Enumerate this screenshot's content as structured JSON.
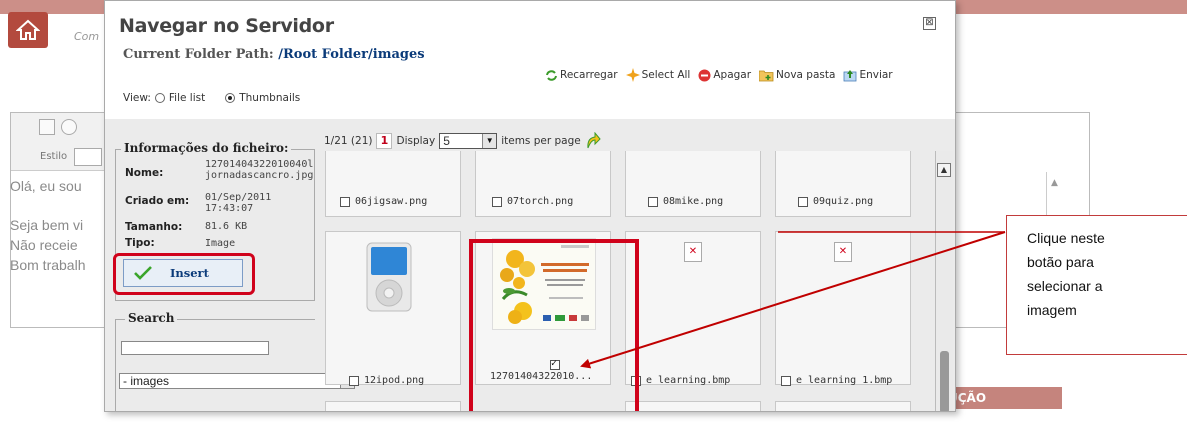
{
  "background": {
    "com_fragment": "Com",
    "estilo_label": "Estilo",
    "editor_lines": [
      "Olá, eu sou",
      "Seja bem vi",
      "Não receie",
      "Bom trabalh"
    ],
    "section_fragment": "UÇÃO"
  },
  "dialog": {
    "title": "Navegar no Servidor",
    "close_symbol": "⊠",
    "folder_path_label": "Current Folder Path: ",
    "folder_path_value": "/Root Folder/images",
    "toolbar": {
      "reload": "Recarregar",
      "select_all": "Select All",
      "delete": "Apagar",
      "new_folder": "Nova pasta",
      "upload": "Enviar"
    },
    "view": {
      "label": "View:",
      "option_list": "File list",
      "option_thumbs": "Thumbnails",
      "selected": "Thumbnails"
    },
    "file_info": {
      "legend": "Informações do ficheiro:",
      "name_label": "Nome:",
      "name_value": "12701404322010040l\njornadascancro.jpg",
      "created_label": "Criado em:",
      "created_value": "01/Sep/2011\n17:43:07",
      "size_label": "Tamanho:",
      "size_value": "81.6 KB",
      "type_label": "Tipo:",
      "type_value": "Image",
      "insert_label": "Insert"
    },
    "search": {
      "legend": "Search",
      "input_value": "",
      "folder_selected": "- images"
    },
    "pager": {
      "range": "1/21 (21)",
      "page": "1",
      "display_label": "Display",
      "per_page_value": "5",
      "per_page_suffix": "items per page"
    },
    "files_row1": [
      "06jigsaw.png",
      "07torch.png",
      "08mike.png",
      "09quiz.png"
    ],
    "files_row2": [
      {
        "name": "12ipod.png",
        "checked": false
      },
      {
        "name": "12701404322010...",
        "checked": true
      },
      {
        "name": "e learning.bmp",
        "checked": false
      },
      {
        "name": "e learning 1.bmp",
        "checked": false
      }
    ]
  },
  "callout": {
    "line1": "Clique neste",
    "line2": "botão para",
    "line3": "selecionar a",
    "line4": "imagem"
  },
  "colors": {
    "annotation_red": "#d0021b",
    "header_brand": "#b34a3e",
    "link_blue": "#0b3b7a"
  }
}
